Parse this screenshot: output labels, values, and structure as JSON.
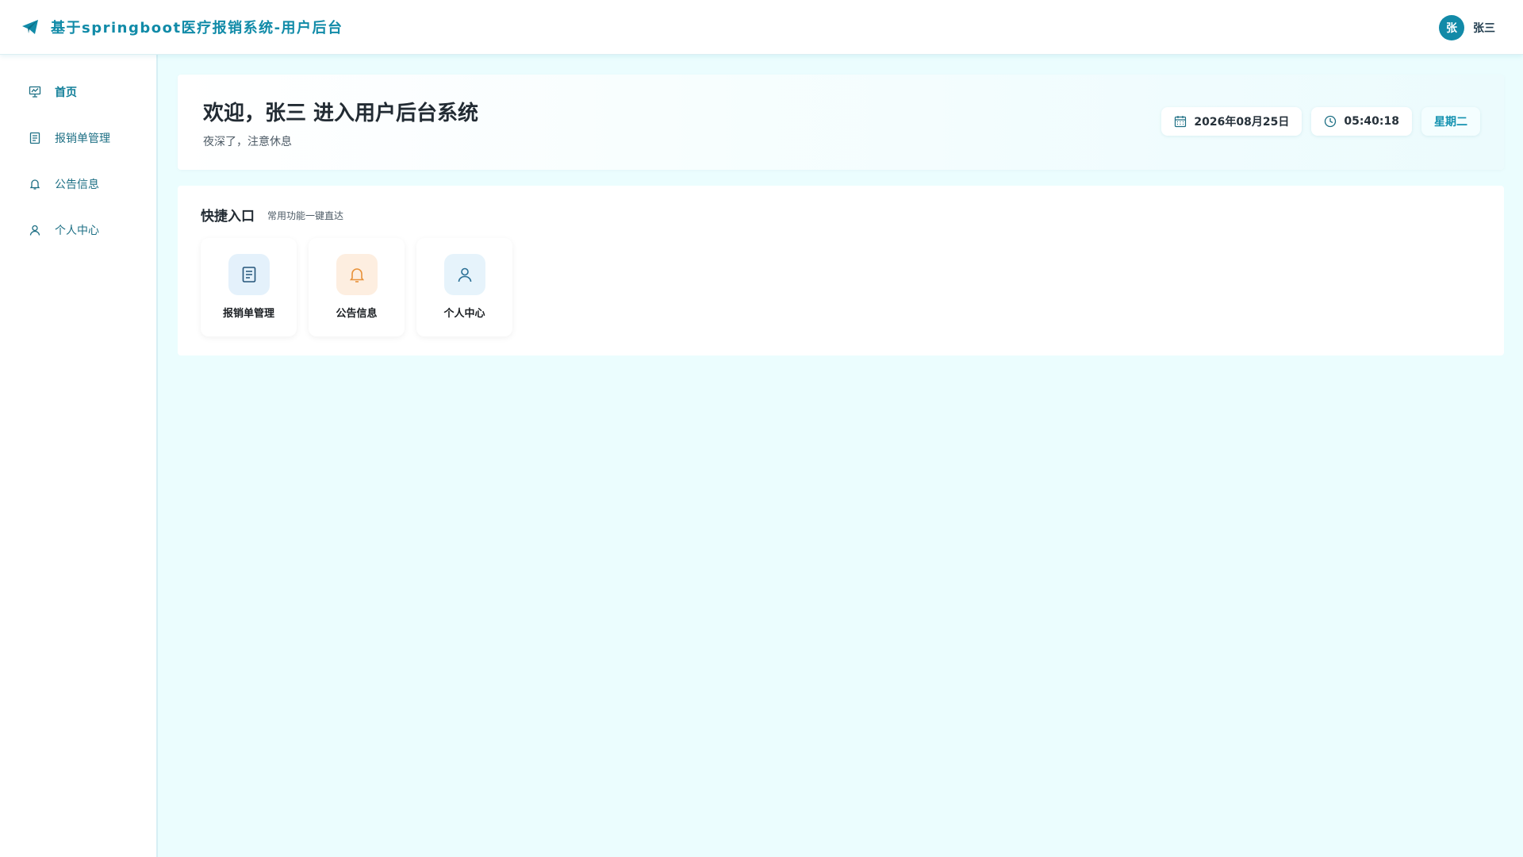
{
  "header": {
    "app_title": "基于springboot医疗报销系统-用户后台",
    "logo_icon": "paper-plane-icon",
    "user": {
      "avatar_text": "张",
      "name": "张三"
    }
  },
  "sidebar": {
    "items": [
      {
        "label": "首页",
        "icon": "presentation-chart-icon",
        "active": true
      },
      {
        "label": "报销单管理",
        "icon": "document-list-icon",
        "active": false
      },
      {
        "label": "公告信息",
        "icon": "bell-icon",
        "active": false
      },
      {
        "label": "个人中心",
        "icon": "user-icon",
        "active": false
      }
    ]
  },
  "welcome": {
    "title": "欢迎，张三 进入用户后台系统",
    "subtitle": "夜深了，注意休息",
    "date": "2026年08月25日",
    "time": "05:40:18",
    "weekday": "星期二"
  },
  "quick": {
    "title": "快捷入口",
    "subtitle": "常用功能一键直达",
    "items": [
      {
        "label": "报销单管理",
        "icon": "document-list-icon"
      },
      {
        "label": "公告信息",
        "icon": "bell-icon"
      },
      {
        "label": "个人中心",
        "icon": "user-icon"
      }
    ]
  },
  "colors": {
    "brand": "#118ba8",
    "background": "#ebfdfe",
    "orange_accent": "#e8923a"
  }
}
